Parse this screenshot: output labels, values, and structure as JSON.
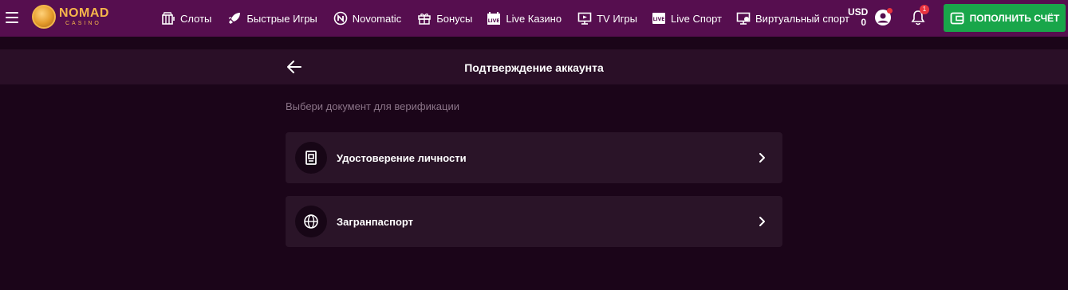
{
  "header": {
    "logo": {
      "main": "NOMAD",
      "sub": "CASINO"
    },
    "nav": [
      {
        "label": "Слоты",
        "icon": "slots-icon"
      },
      {
        "label": "Быстрые Игры",
        "icon": "rocket-icon"
      },
      {
        "label": "Novomatic",
        "icon": "novomatic-icon"
      },
      {
        "label": "Бонусы",
        "icon": "gift-icon"
      },
      {
        "label": "Live Казино",
        "icon": "live-casino-icon"
      },
      {
        "label": "TV Игры",
        "icon": "tv-icon"
      },
      {
        "label": "Live Спорт",
        "icon": "live-sport-icon"
      },
      {
        "label": "Виртуальный спорт",
        "icon": "virtual-sport-icon"
      }
    ],
    "wallet": {
      "currency": "USD",
      "balance": "0"
    },
    "notifications": {
      "count": "1"
    },
    "deposit_label": "ПОПОЛНИТЬ СЧЁТ"
  },
  "page": {
    "title": "Подтверждение аккаунта",
    "hint": "Выбери документ для верификации",
    "documents": [
      {
        "label": "Удостоверение личности",
        "icon": "id-card-icon"
      },
      {
        "label": "Загранпаспорт",
        "icon": "globe-icon"
      }
    ]
  },
  "colors": {
    "topbar": "#560e4f",
    "background": "#1b0519",
    "card": "#2a1428",
    "deposit": "#19a64a",
    "logo": "#f6b64b",
    "badge": "#e8333f"
  }
}
